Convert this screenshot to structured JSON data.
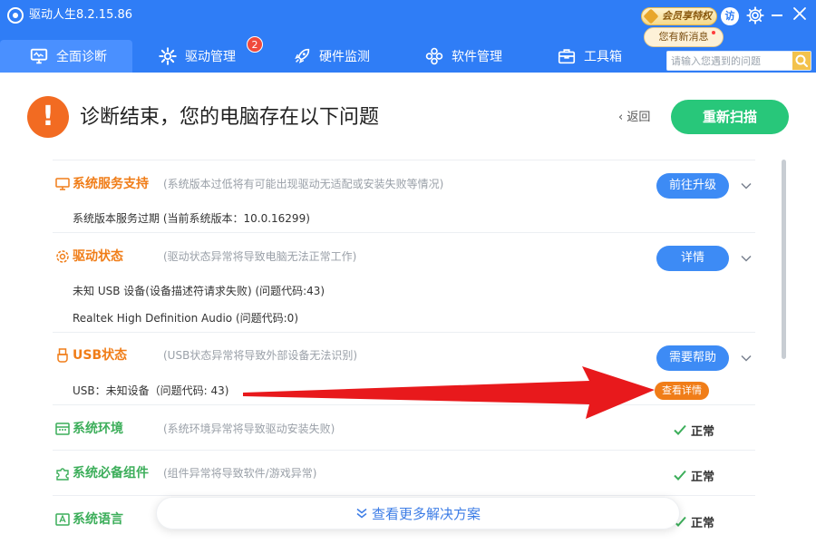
{
  "window": {
    "title": "驱动人生8.2.15.86",
    "vip_label": "会员享特权",
    "message_label": "您有新消息",
    "avatar_text": "访"
  },
  "nav": {
    "tabs": [
      {
        "label": "全面诊断",
        "icon": "monitor-icon",
        "active": true
      },
      {
        "label": "驱动管理",
        "icon": "gear-icon",
        "badge": "2"
      },
      {
        "label": "硬件监测",
        "icon": "rocket-icon"
      },
      {
        "label": "软件管理",
        "icon": "apps-icon"
      },
      {
        "label": "工具箱",
        "icon": "toolbox-icon"
      }
    ],
    "search_placeholder": "请输入您遇到的问题"
  },
  "header": {
    "title": "诊断结束，您的电脑存在以下问题",
    "back_label": "返回",
    "rescan_label": "重新扫描"
  },
  "sections": [
    {
      "title": "系统服务支持",
      "description": "(系统版本过低将有可能出现驱动无适配或安装失败等情况)",
      "status": "warning",
      "button": "前往升级",
      "details": [
        "系统版本服务过期 (当前系统版本：10.0.16299)"
      ]
    },
    {
      "title": "驱动状态",
      "description": "(驱动状态异常将导致电脑无法正常工作)",
      "status": "warning",
      "button": "详情",
      "details": [
        "未知 USB 设备(设备描述符请求失败) (问题代码:43)",
        "Realtek High Definition Audio (问题代码:0)"
      ]
    },
    {
      "title": "USB状态",
      "description": "(USB状态异常将导致外部设备无法识别)",
      "status": "warning",
      "button": "需要帮助",
      "details": [
        "USB：未知设备（问题代码: 43)"
      ],
      "detail_button": "查看详情"
    },
    {
      "title": "系统环境",
      "description": "(系统环境异常将导致驱动安装失败)",
      "status": "ok",
      "status_label": "正常"
    },
    {
      "title": "系统必备组件",
      "description": "(组件异常将导致软件/游戏异常)",
      "status": "ok",
      "status_label": "正常"
    },
    {
      "title": "系统语言",
      "status": "ok",
      "status_label": "正常"
    }
  ],
  "more_solutions_label": "查看更多解决方案",
  "colors": {
    "brand_blue": "#2f7df6",
    "warning_orange": "#f07d18",
    "ok_green": "#3cae5a",
    "rescan_green": "#28c77a",
    "annotation_red": "#e8191c"
  }
}
